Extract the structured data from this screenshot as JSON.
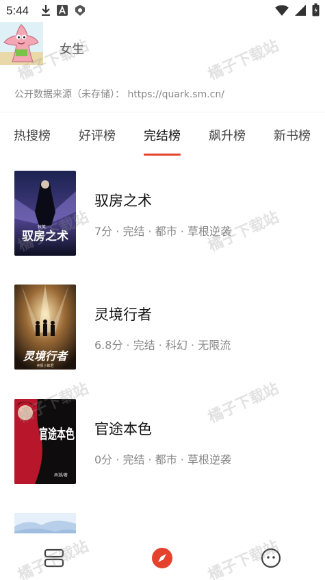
{
  "status_bar": {
    "time": "5:44",
    "icons_left": [
      "download-icon",
      "a-app-icon",
      "shield-app-icon"
    ],
    "icons_right": [
      "wifi-icon",
      "signal-icon",
      "battery-icon"
    ]
  },
  "profile": {
    "username": "女生",
    "data_source": "公开数据来源（未存储）： https://quark.sm.cn/"
  },
  "tabs": [
    {
      "label": "热搜榜",
      "active": false
    },
    {
      "label": "好评榜",
      "active": false
    },
    {
      "label": "完结榜",
      "active": true
    },
    {
      "label": "飙升榜",
      "active": false
    },
    {
      "label": "新书榜",
      "active": false
    }
  ],
  "books": [
    {
      "title": "驭房之术",
      "meta": "7分 · 完结 · 都市 · 草根逆袭",
      "cover_text": "驭房之术",
      "cover_author": "牧笑"
    },
    {
      "title": "灵境行者",
      "meta": "6.8分 · 完结 · 科幻 · 无限流",
      "cover_text": "灵境行者",
      "cover_author": "卖报小郎君"
    },
    {
      "title": "官途本色",
      "meta": "0分 · 完结 · 都市 · 草根逆袭",
      "cover_text": "官途本色",
      "cover_author": "弄潮/著"
    },
    {
      "title": "",
      "meta": "",
      "cover_text": "",
      "cover_author": ""
    }
  ],
  "bottom_nav": [
    {
      "icon": "bookshelf-icon",
      "active": false
    },
    {
      "icon": "compass-icon",
      "active": true
    },
    {
      "icon": "face-icon",
      "active": false
    }
  ],
  "watermark": "橘子下载站",
  "colors": {
    "accent": "#e5422d",
    "text_primary": "#111111",
    "text_secondary": "#888888"
  }
}
